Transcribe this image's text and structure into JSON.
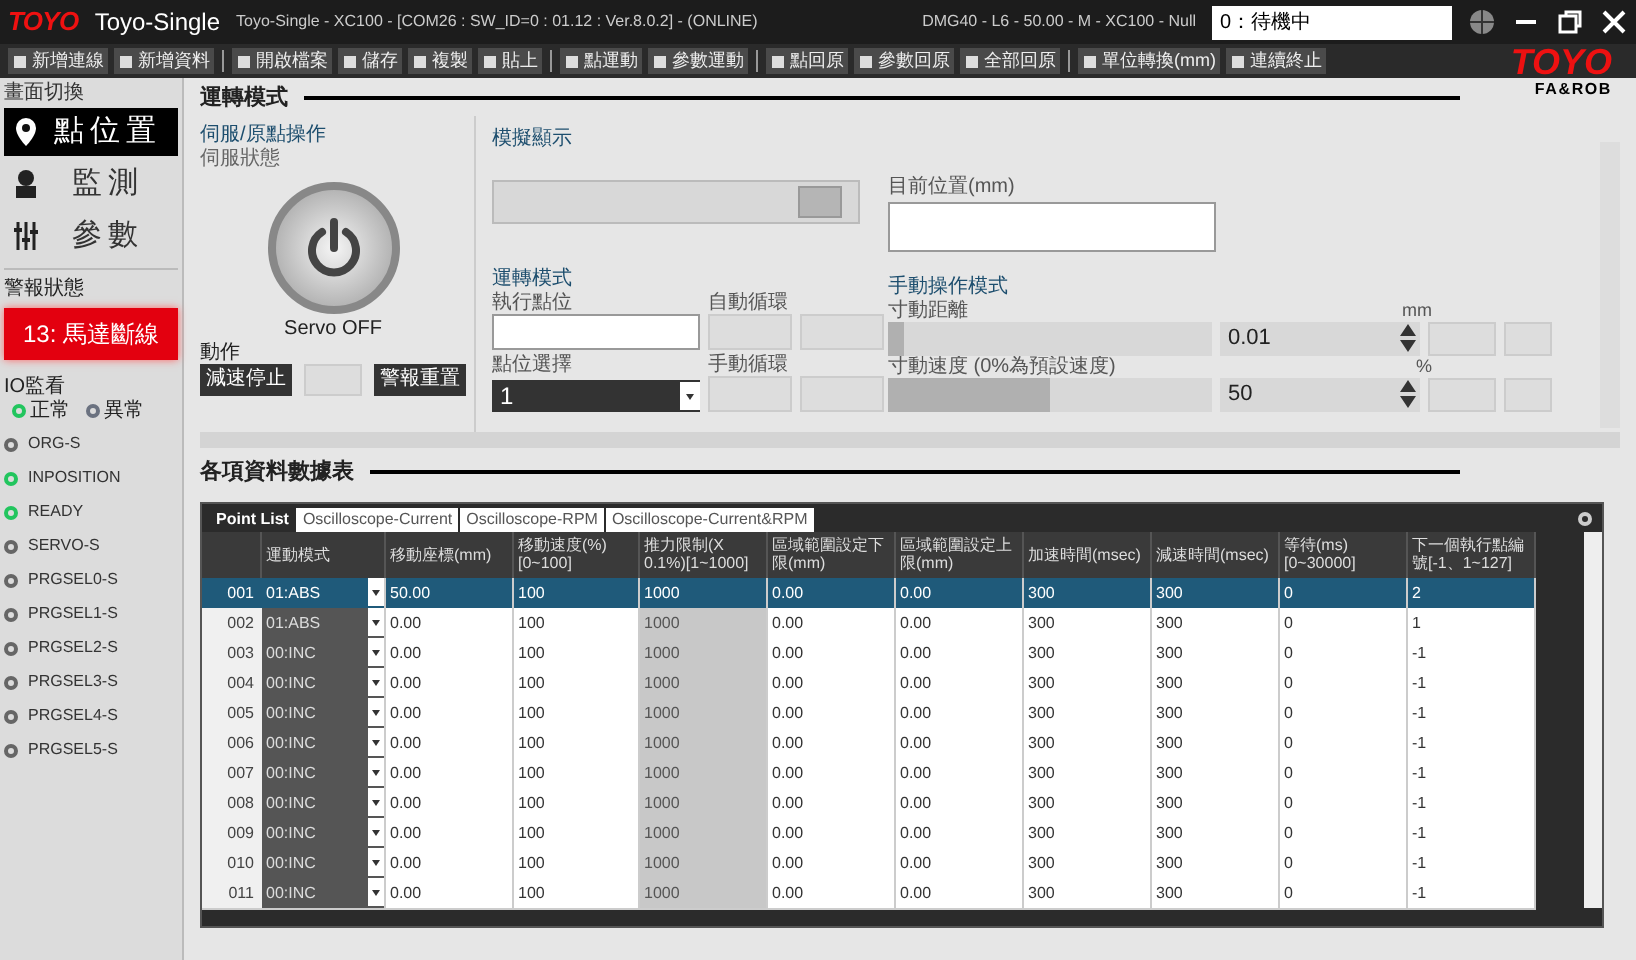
{
  "title_bar": {
    "logo": "TOYO",
    "app_name": "Toyo-Single",
    "title": "Toyo-Single - XC100 - [COM26 : SW_ID=0 : 01.12 : Ver.8.0.2] - (ONLINE)",
    "device": "DMG40 - L6 - 50.00 - M - XC100 - Null",
    "status": "0：待機中"
  },
  "toolbar": [
    {
      "label": "新增連線",
      "separator_before": false
    },
    {
      "label": "新增資料",
      "separator_before": false
    },
    {
      "label": "開啟檔案",
      "separator_before": true
    },
    {
      "label": "儲存",
      "separator_before": false
    },
    {
      "label": "複製",
      "separator_before": false
    },
    {
      "label": "貼上",
      "separator_before": false
    },
    {
      "label": "點運動",
      "separator_before": true
    },
    {
      "label": "參數運動",
      "separator_before": false
    },
    {
      "label": "點回原",
      "separator_before": true
    },
    {
      "label": "參數回原",
      "separator_before": false
    },
    {
      "label": "全部回原",
      "separator_before": false
    },
    {
      "label": "單位轉換(mm)",
      "separator_before": true
    },
    {
      "label": "連續終止",
      "separator_before": false
    }
  ],
  "brand": {
    "logo": "TOYO",
    "tagline": "FA&ROB"
  },
  "sidebar": {
    "heading": "畫面切換",
    "nav": [
      {
        "label": "點位置",
        "kind": "pin",
        "selected": true
      },
      {
        "label": "監測",
        "kind": "monitor",
        "selected": false
      },
      {
        "label": "參數",
        "kind": "params",
        "selected": false
      }
    ],
    "alarm_heading": "警報狀態",
    "alarm": "13: 馬達斷線",
    "io_heading": "IO監看",
    "legend": [
      {
        "label": "正常",
        "color": "#22c55e"
      },
      {
        "label": "異常",
        "color": "#6b7280"
      }
    ],
    "signals": [
      {
        "name": "ORG-S",
        "on": false
      },
      {
        "name": "INPOSITION",
        "on": true
      },
      {
        "name": "READY",
        "on": true
      },
      {
        "name": "SERVO-S",
        "on": false
      },
      {
        "name": "PRGSEL0-S",
        "on": false
      },
      {
        "name": "PRGSEL1-S",
        "on": false
      },
      {
        "name": "PRGSEL2-S",
        "on": false
      },
      {
        "name": "PRGSEL3-S",
        "on": false
      },
      {
        "name": "PRGSEL4-S",
        "on": false
      },
      {
        "name": "PRGSEL5-S",
        "on": false
      }
    ]
  },
  "operation": {
    "heading": "運轉模式",
    "servo": {
      "heading": "伺服/原點操作",
      "state_label": "伺服狀態",
      "servo_on": false,
      "state_text": "Servo OFF",
      "action_label": "動作",
      "buttons": [
        {
          "kind": "dark",
          "label": "減速停止"
        },
        {
          "kind": "blank"
        },
        {
          "kind": "dark",
          "label": "警報重置"
        }
      ]
    },
    "simulation": {
      "heading": "模擬顯示",
      "level": 0.95
    },
    "position": {
      "label": "目前位置(mm)"
    },
    "run_mode": {
      "heading": "運轉模式",
      "point_label": "執行點位",
      "auto_label": "自動循環",
      "select_label": "點位選擇",
      "select_value": "1",
      "manual_label": "手動循環"
    },
    "manual": {
      "heading": "手動操作模式",
      "rows": [
        {
          "label": "寸動距離",
          "unit": "mm",
          "value": "0.01",
          "level": 0.05
        },
        {
          "label": "寸動速度 (0%為預設速度)",
          "unit": "%",
          "value": "50",
          "level": 0.5
        }
      ]
    }
  },
  "table": {
    "heading": "各項資料數據表",
    "tabs": [
      {
        "label": "Point List",
        "selected": true
      },
      {
        "label": "Oscilloscope-Current",
        "selected": false
      },
      {
        "label": "Oscilloscope-RPM",
        "selected": false
      },
      {
        "label": "Oscilloscope-Current&RPM",
        "selected": false
      }
    ],
    "columns": [
      "運動模式",
      "移動座標(mm)",
      "移動速度(%)[0~100]",
      "推力限制(X 0.1%)[1~1000]",
      "區域範圍設定下限(mm)",
      "區域範圍設定上限(mm)",
      "加速時間(msec)",
      "減速時間(msec)",
      "等待(ms)[0~30000]",
      "下一個執行點編號[-1、1~127]"
    ],
    "rows": [
      {
        "no": "001",
        "selected": true,
        "disabled": false,
        "cells": [
          "01:ABS",
          "50.00",
          "100",
          "1000",
          "0.00",
          "0.00",
          "300",
          "300",
          "0",
          "2"
        ]
      },
      {
        "no": "002",
        "selected": false,
        "disabled": true,
        "cells": [
          "01:ABS",
          "0.00",
          "100",
          "1000",
          "0.00",
          "0.00",
          "300",
          "300",
          "0",
          "1"
        ]
      },
      {
        "no": "003",
        "selected": false,
        "disabled": true,
        "cells": [
          "00:INC",
          "0.00",
          "100",
          "1000",
          "0.00",
          "0.00",
          "300",
          "300",
          "0",
          "-1"
        ]
      },
      {
        "no": "004",
        "selected": false,
        "disabled": true,
        "cells": [
          "00:INC",
          "0.00",
          "100",
          "1000",
          "0.00",
          "0.00",
          "300",
          "300",
          "0",
          "-1"
        ]
      },
      {
        "no": "005",
        "selected": false,
        "disabled": true,
        "cells": [
          "00:INC",
          "0.00",
          "100",
          "1000",
          "0.00",
          "0.00",
          "300",
          "300",
          "0",
          "-1"
        ]
      },
      {
        "no": "006",
        "selected": false,
        "disabled": true,
        "cells": [
          "00:INC",
          "0.00",
          "100",
          "1000",
          "0.00",
          "0.00",
          "300",
          "300",
          "0",
          "-1"
        ]
      },
      {
        "no": "007",
        "selected": false,
        "disabled": true,
        "cells": [
          "00:INC",
          "0.00",
          "100",
          "1000",
          "0.00",
          "0.00",
          "300",
          "300",
          "0",
          "-1"
        ]
      },
      {
        "no": "008",
        "selected": false,
        "disabled": true,
        "cells": [
          "00:INC",
          "0.00",
          "100",
          "1000",
          "0.00",
          "0.00",
          "300",
          "300",
          "0",
          "-1"
        ]
      },
      {
        "no": "009",
        "selected": false,
        "disabled": true,
        "cells": [
          "00:INC",
          "0.00",
          "100",
          "1000",
          "0.00",
          "0.00",
          "300",
          "300",
          "0",
          "-1"
        ]
      },
      {
        "no": "010",
        "selected": false,
        "disabled": true,
        "cells": [
          "00:INC",
          "0.00",
          "100",
          "1000",
          "0.00",
          "0.00",
          "300",
          "300",
          "0",
          "-1"
        ]
      },
      {
        "no": "011",
        "selected": false,
        "disabled": true,
        "cells": [
          "00:INC",
          "0.00",
          "100",
          "1000",
          "0.00",
          "0.00",
          "300",
          "300",
          "0",
          "-1"
        ]
      }
    ]
  }
}
